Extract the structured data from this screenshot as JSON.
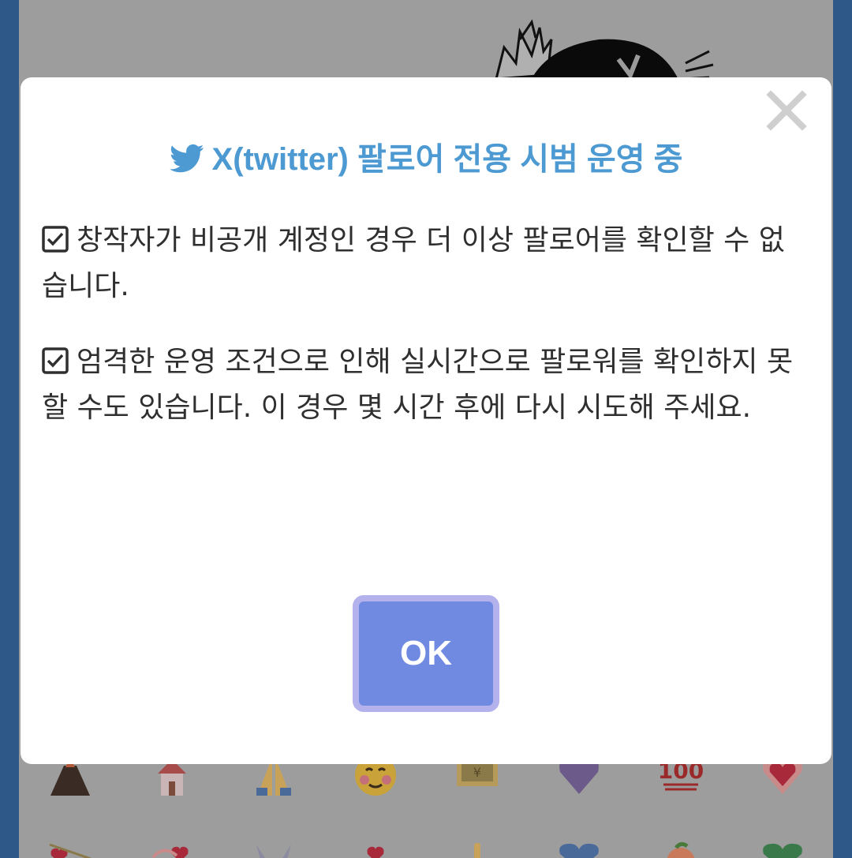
{
  "dialog": {
    "title": "X(twitter) 팔로어 전용 시범 운영 중",
    "title_icon": "twitter-bird-icon",
    "accent_color": "#4d9ad3",
    "notices": [
      {
        "icon": "checkbox-checked-icon",
        "text": "창작자가 비공개 계정인 경우 더 이상 팔로어를 확인할 수 없습니다."
      },
      {
        "icon": "checkbox-checked-icon",
        "text": "엄격한 운영 조건으로 인해 실시간으로 팔로워를 확인하지 못할 수도 있습니다. 이 경우 몇 시간 후에 다시 시도해 주세요."
      }
    ],
    "ok_label": "OK",
    "ok_color": "#6f8ae0",
    "close_icon": "close-icon"
  },
  "background": {
    "emoji_row_1": [
      "volcano-icon",
      "wedding-chapel-icon",
      "folded-hands-icon",
      "smiling-face-icon",
      "yen-banknote-icon",
      "purple-heart-icon",
      "hundred-points-icon",
      "growing-heart-icon"
    ],
    "emoji_row_2": [
      "heart-arrow-icon",
      "heart-ribbon-icon",
      "rabbit-ears-icon",
      "small-heart-icon",
      "thumb-icon",
      "blue-heart-icon",
      "peach-icon",
      "green-heart-icon"
    ]
  }
}
